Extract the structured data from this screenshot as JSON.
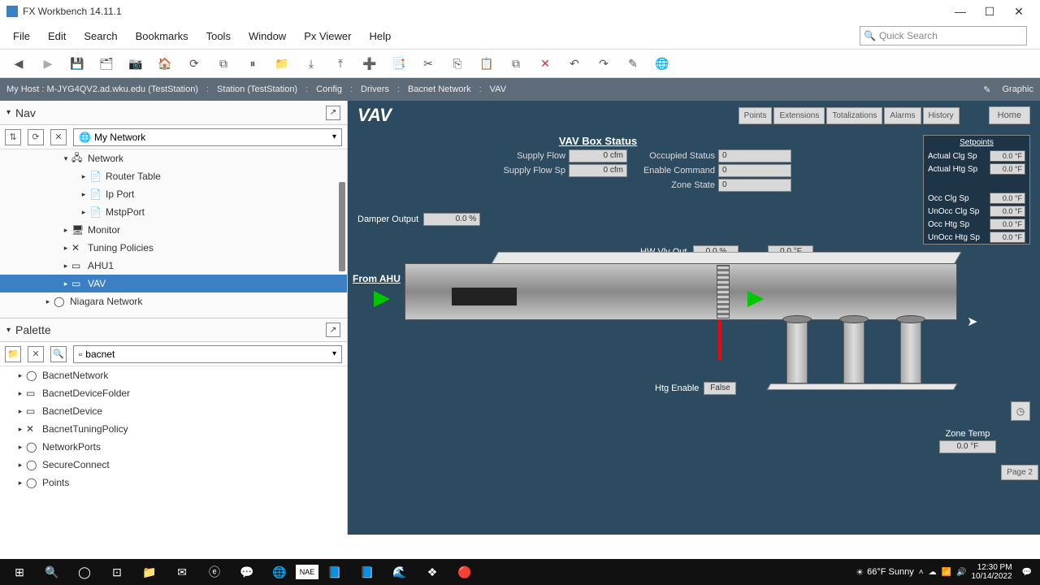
{
  "app": {
    "title": "FX Workbench 14.11.1"
  },
  "menus": [
    "File",
    "Edit",
    "Search",
    "Bookmarks",
    "Tools",
    "Window",
    "Px Viewer",
    "Help"
  ],
  "quick_search_placeholder": "Quick Search",
  "breadcrumb": {
    "host": "My Host : M-JYG4QV2.ad.wku.edu (TestStation)",
    "parts": [
      "Station (TestStation)",
      "Config",
      "Drivers",
      "Bacnet Network",
      "VAV"
    ],
    "mode": "Graphic"
  },
  "nav": {
    "title": "Nav",
    "combo": "My Network",
    "items": [
      {
        "indent": 3,
        "toggle": "▾",
        "icon": "🖧",
        "label": "Network"
      },
      {
        "indent": 4,
        "toggle": "▸",
        "icon": "📄",
        "label": "Router Table"
      },
      {
        "indent": 4,
        "toggle": "▸",
        "icon": "📄",
        "label": "Ip Port"
      },
      {
        "indent": 4,
        "toggle": "▸",
        "icon": "📄",
        "label": "MstpPort"
      },
      {
        "indent": 3,
        "toggle": "▸",
        "icon": "🖥",
        "label": "Monitor"
      },
      {
        "indent": 3,
        "toggle": "▸",
        "icon": "✕",
        "label": "Tuning Policies"
      },
      {
        "indent": 3,
        "toggle": "▸",
        "icon": "▭",
        "label": "AHU1"
      },
      {
        "indent": 3,
        "toggle": "▸",
        "icon": "▭",
        "label": "VAV",
        "selected": true
      },
      {
        "indent": 2,
        "toggle": "▸",
        "icon": "◯",
        "label": "Niagara Network"
      }
    ]
  },
  "palette": {
    "title": "Palette",
    "combo": "bacnet",
    "items": [
      {
        "icon": "◯",
        "label": "BacnetNetwork"
      },
      {
        "icon": "▭",
        "label": "BacnetDeviceFolder"
      },
      {
        "icon": "▭",
        "label": "BacnetDevice"
      },
      {
        "icon": "✕",
        "label": "BacnetTuningPolicy"
      },
      {
        "icon": "◯",
        "label": "NetworkPorts"
      },
      {
        "icon": "◯",
        "label": "SecureConnect"
      },
      {
        "icon": "◯",
        "label": "Points"
      }
    ]
  },
  "view": {
    "title": "VAV",
    "tabs": [
      "Points",
      "Extensions",
      "Totalizations",
      "Alarms",
      "History"
    ],
    "home": "Home",
    "status_title": "VAV Box Status",
    "left_rows": [
      {
        "label": "Supply Flow",
        "value": "0 cfm"
      },
      {
        "label": "Supply Flow Sp",
        "value": "0 cfm"
      }
    ],
    "right_rows": [
      {
        "label": "Occupied Status",
        "value": "0"
      },
      {
        "label": "Enable Command",
        "value": "0"
      },
      {
        "label": "Zone State",
        "value": "0"
      }
    ],
    "damper": {
      "label": "Damper Output",
      "value": "0.0 %"
    },
    "hw": {
      "label": "HW Vlv Out",
      "pct": "0.0 %",
      "temp": "0.0 °F"
    },
    "from": "From  AHU",
    "htg": {
      "label": "Htg Enable",
      "value": "False"
    },
    "zone_temp": {
      "label": "Zone Temp",
      "value": "0.0 °F"
    },
    "page2": "Page 2",
    "setpoints": {
      "title": "Setpoints",
      "group1": [
        {
          "label": "Actual Clg Sp",
          "value": "0.0 °F"
        },
        {
          "label": "Actual Htg Sp",
          "value": "0.0 °F"
        }
      ],
      "group2": [
        {
          "label": "Occ Clg Sp",
          "value": "0.0 °F"
        },
        {
          "label": "UnOcc Clg Sp",
          "value": "0.0 °F"
        },
        {
          "label": "Occ Htg Sp",
          "value": "0.0 °F"
        },
        {
          "label": "UnOcc Htg Sp",
          "value": "0.0 °F"
        }
      ]
    }
  },
  "taskbar": {
    "weather": "66°F  Sunny",
    "time": "12:30 PM",
    "date": "10/14/2022"
  }
}
